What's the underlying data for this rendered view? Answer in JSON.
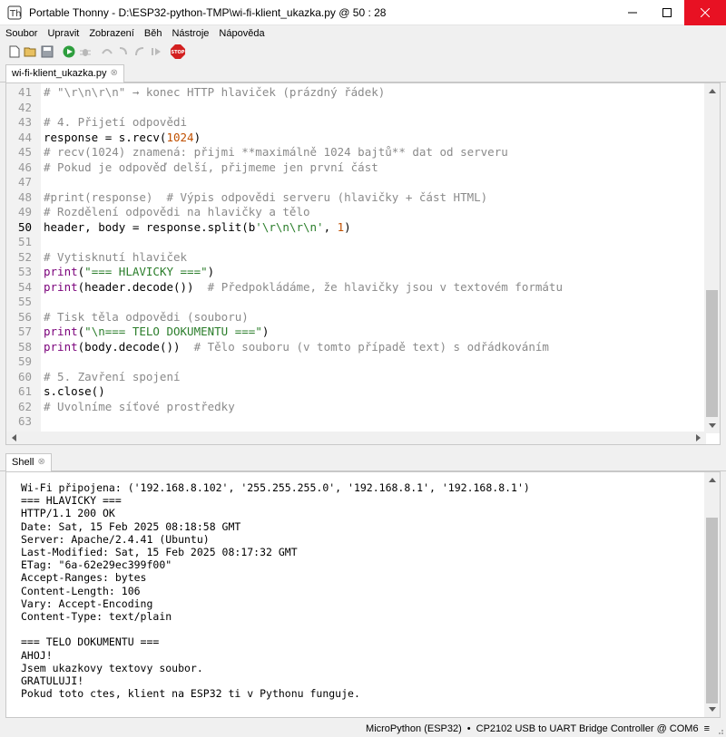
{
  "window": {
    "title": "Portable Thonny  -  D:\\ESP32-python-TMP\\wi-fi-klient_ukazka.py  @  50 : 28"
  },
  "menu": [
    "Soubor",
    "Upravit",
    "Zobrazení",
    "Běh",
    "Nástroje",
    "Nápověda"
  ],
  "toolbar": {
    "icons": [
      "new-file-icon",
      "open-file-icon",
      "save-icon",
      "run-icon",
      "debug-icon",
      "step-over-icon",
      "step-into-icon",
      "step-out-icon",
      "resume-icon",
      "stop-icon"
    ],
    "stop_label": "STOP"
  },
  "editor": {
    "tab_label": "wi-fi-klient_ukazka.py",
    "tab_close": "⊗",
    "current_line": 50,
    "lines": [
      {
        "n": "41",
        "parts": [
          [
            "c",
            "# \"\\r\\n\\r\\n\" → konec HTTP hlaviček (prázdný řádek)"
          ]
        ]
      },
      {
        "n": "42",
        "parts": []
      },
      {
        "n": "43",
        "parts": [
          [
            "c",
            "# 4. Přijetí odpovědi"
          ]
        ]
      },
      {
        "n": "44",
        "parts": [
          [
            "p",
            "response = s.recv("
          ],
          [
            "n",
            "1024"
          ],
          [
            "p",
            ")"
          ]
        ]
      },
      {
        "n": "45",
        "parts": [
          [
            "c",
            "# recv(1024) znamená: přijmi **maximálně 1024 bajtů** dat od serveru"
          ]
        ]
      },
      {
        "n": "46",
        "parts": [
          [
            "c",
            "# Pokud je odpověď delší, přijmeme jen první část"
          ]
        ]
      },
      {
        "n": "47",
        "parts": []
      },
      {
        "n": "48",
        "parts": [
          [
            "c",
            "#print(response)  # Výpis odpovědi serveru (hlavičky + část HTML)"
          ]
        ]
      },
      {
        "n": "49",
        "parts": [
          [
            "c",
            "# Rozdělení odpovědi na hlavičky a tělo"
          ]
        ]
      },
      {
        "n": "50",
        "parts": [
          [
            "p",
            "header, body = response.split(b"
          ],
          [
            "s",
            "'\\r\\n\\r\\n'"
          ],
          [
            "p",
            ", "
          ],
          [
            "n",
            "1"
          ],
          [
            "p",
            ")"
          ]
        ]
      },
      {
        "n": "51",
        "parts": []
      },
      {
        "n": "52",
        "parts": [
          [
            "c",
            "# Vytisknutí hlaviček"
          ]
        ]
      },
      {
        "n": "53",
        "parts": [
          [
            "k",
            "print"
          ],
          [
            "p",
            "("
          ],
          [
            "s",
            "\"=== HLAVICKY ===\""
          ],
          [
            "p",
            ")"
          ]
        ]
      },
      {
        "n": "54",
        "parts": [
          [
            "k",
            "print"
          ],
          [
            "p",
            "(header.decode())  "
          ],
          [
            "c",
            "# Předpokládáme, že hlavičky jsou v textovém formátu"
          ]
        ]
      },
      {
        "n": "55",
        "parts": []
      },
      {
        "n": "56",
        "parts": [
          [
            "c",
            "# Tisk těla odpovědi (souboru)"
          ]
        ]
      },
      {
        "n": "57",
        "parts": [
          [
            "k",
            "print"
          ],
          [
            "p",
            "("
          ],
          [
            "s",
            "\"\\n=== TELO DOKUMENTU ===\""
          ],
          [
            "p",
            ")"
          ]
        ]
      },
      {
        "n": "58",
        "parts": [
          [
            "k",
            "print"
          ],
          [
            "p",
            "(body.decode())  "
          ],
          [
            "c",
            "# Tělo souboru (v tomto případě text) s odřádkováním"
          ]
        ]
      },
      {
        "n": "59",
        "parts": []
      },
      {
        "n": "60",
        "parts": [
          [
            "c",
            "# 5. Zavření spojení"
          ]
        ]
      },
      {
        "n": "61",
        "parts": [
          [
            "p",
            "s.close()"
          ]
        ]
      },
      {
        "n": "62",
        "parts": [
          [
            "c",
            "# Uvolníme síťové prostředky"
          ]
        ]
      },
      {
        "n": "63",
        "parts": []
      }
    ]
  },
  "shell": {
    "tab_label": "Shell",
    "tab_close": "⊗",
    "lines": [
      "Wi-Fi připojena: ('192.168.8.102', '255.255.255.0', '192.168.8.1', '192.168.8.1')",
      "=== HLAVICKY ===",
      "HTTP/1.1 200 OK",
      "Date: Sat, 15 Feb 2025 08:18:58 GMT",
      "Server: Apache/2.4.41 (Ubuntu)",
      "Last-Modified: Sat, 15 Feb 2025 08:17:32 GMT",
      "ETag: \"6a-62e29ec399f00\"",
      "Accept-Ranges: bytes",
      "Content-Length: 106",
      "Vary: Accept-Encoding",
      "Content-Type: text/plain",
      "",
      "=== TELO DOKUMENTU ===",
      "AHOJ!",
      "Jsem ukazkovy textovy soubor.",
      "GRATULUJI!",
      "Pokud toto ctes, klient na ESP32 ti v Pythonu funguje."
    ]
  },
  "status": {
    "interpreter": "MicroPython (ESP32)",
    "separator": "•",
    "port": "CP2102 USB to UART Bridge Controller @ COM6",
    "menu_indicator": "≡"
  },
  "colors": {
    "comment": "#8a8a8a",
    "keyword": "#7a007a",
    "string": "#2a7d2a",
    "number": "#c05000",
    "close_button": "#e81123"
  }
}
